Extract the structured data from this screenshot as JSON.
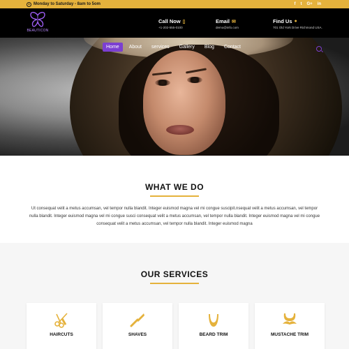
{
  "topbar": {
    "hours": "Monday to Saturday - 8am to 5om",
    "socials": [
      "f",
      "t",
      "G+",
      "in"
    ]
  },
  "header": {
    "logo_text": "BEAUTICON",
    "call": {
      "title": "Call Now",
      "value": "+1-202-555-0100"
    },
    "email": {
      "title": "Email",
      "value": "demo@info.com"
    },
    "find": {
      "title": "Find Us",
      "value": "701 Old York Drive Richmond USA."
    }
  },
  "nav": {
    "items": [
      "Home",
      "About",
      "services",
      "Gallery",
      "Blog",
      "Contact"
    ],
    "active": "Home"
  },
  "what_we_do": {
    "title": "WHAT WE DO",
    "body": "Ut consequat velit a metus accumsan, vel tempor nulla blandit. Integer euismod magna vel mi congue suscipit.nsequat velit a metus accumsan, vel tempor nulla blandit. Integer euismod magna vel mi congue susci consequat velit a metus accumsan, vel tempor nulla blandit. Integer euismod magna vel mi congue consequat velit a metus accumsan, vel tempor nulla blandit. Integer euismod magna"
  },
  "services": {
    "title": "OUR SERVICES",
    "cards": [
      {
        "title": "HAIRCUTS",
        "icon": "scissors-comb-icon"
      },
      {
        "title": "SHAVES",
        "icon": "razor-icon"
      },
      {
        "title": "BEARD TRIM",
        "icon": "beard-icon"
      },
      {
        "title": "MUSTACHE TRIM",
        "icon": "mustache-icon"
      }
    ]
  },
  "colors": {
    "accent": "#e5b23c",
    "brand": "#7b3fd1",
    "header_bg": "#000000"
  }
}
